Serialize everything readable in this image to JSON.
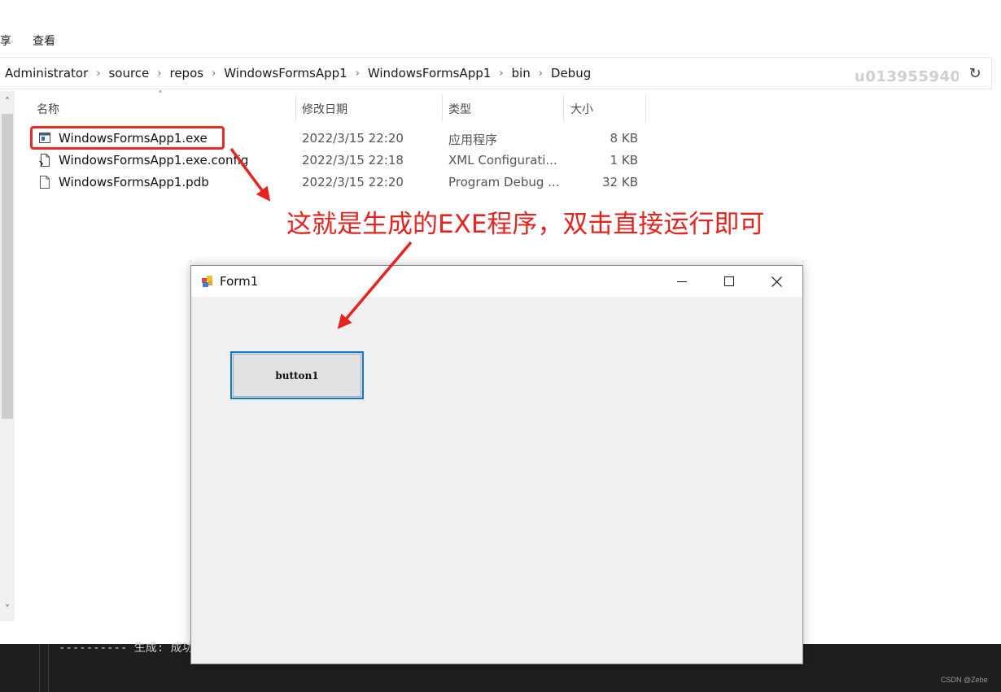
{
  "ribbon": {
    "left_fragment": "享",
    "view_label": "查看"
  },
  "address": {
    "crumbs": [
      "Administrator",
      "source",
      "repos",
      "WindowsFormsApp1",
      "WindowsFormsApp1",
      "bin",
      "Debug"
    ],
    "watermark": "u013955940",
    "refresh_icon": "refresh-icon"
  },
  "columns": {
    "name": "名称",
    "modified": "修改日期",
    "type": "类型",
    "size": "大小"
  },
  "files": [
    {
      "name": "WindowsFormsApp1.exe",
      "date": "2022/3/15 22:20",
      "type": "应用程序",
      "size": "8 KB",
      "icon": "exe-icon"
    },
    {
      "name": "WindowsFormsApp1.exe.config",
      "date": "2022/3/15 22:18",
      "type": "XML Configurati...",
      "size": "1 KB",
      "icon": "config-file-icon"
    },
    {
      "name": "WindowsFormsApp1.pdb",
      "date": "2022/3/15 22:20",
      "type": "Program Debug ...",
      "size": "32 KB",
      "icon": "file-icon"
    }
  ],
  "annotation": "这就是生成的EXE程序，双击直接运行即可",
  "console": {
    "text": "---------- 生成: 成功"
  },
  "form1": {
    "title": "Form1",
    "button_label": "button1",
    "accent": "#0a78d7"
  },
  "footer": {
    "credit": "CSDN @Zebe"
  },
  "colors": {
    "annotation_red": "#e8231d"
  }
}
